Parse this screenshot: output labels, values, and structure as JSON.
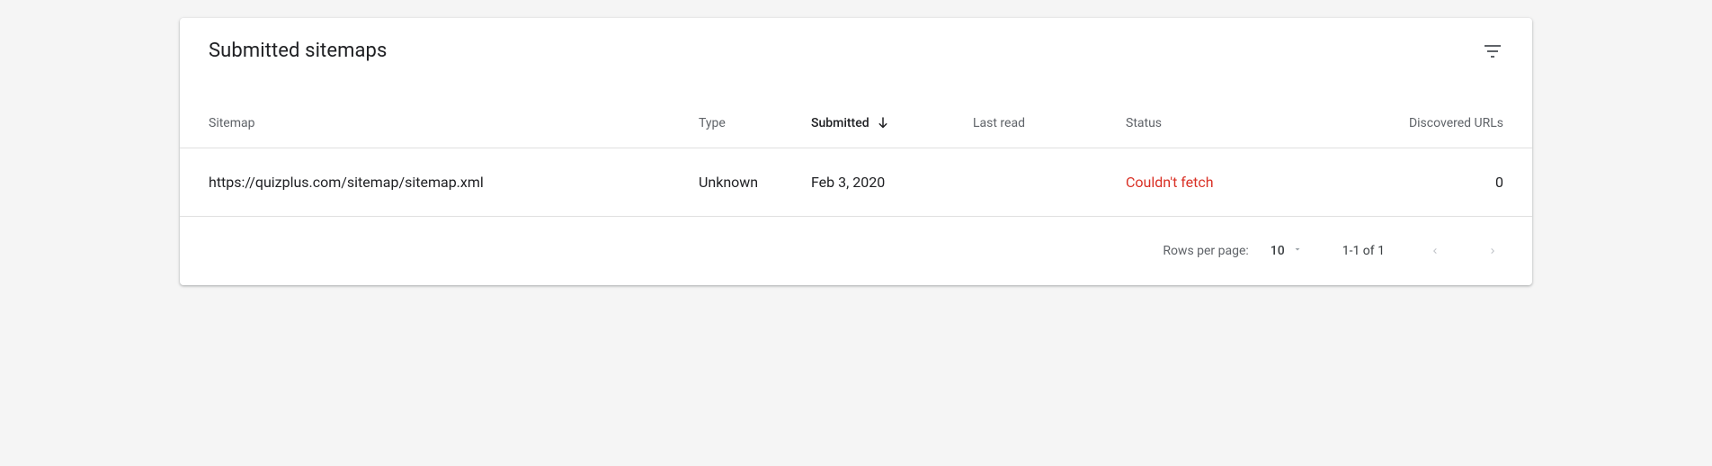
{
  "card": {
    "title": "Submitted sitemaps"
  },
  "columns": {
    "sitemap": "Sitemap",
    "type": "Type",
    "submitted": "Submitted",
    "lastread": "Last read",
    "status": "Status",
    "discovered": "Discovered URLs"
  },
  "rows": [
    {
      "sitemap": "https://quizplus.com/sitemap/sitemap.xml",
      "type": "Unknown",
      "submitted": "Feb 3, 2020",
      "lastread": "",
      "status": "Couldn't fetch",
      "discovered": "0"
    }
  ],
  "footer": {
    "rowsLabel": "Rows per page:",
    "rowsValue": "10",
    "range": "1-1 of 1"
  }
}
